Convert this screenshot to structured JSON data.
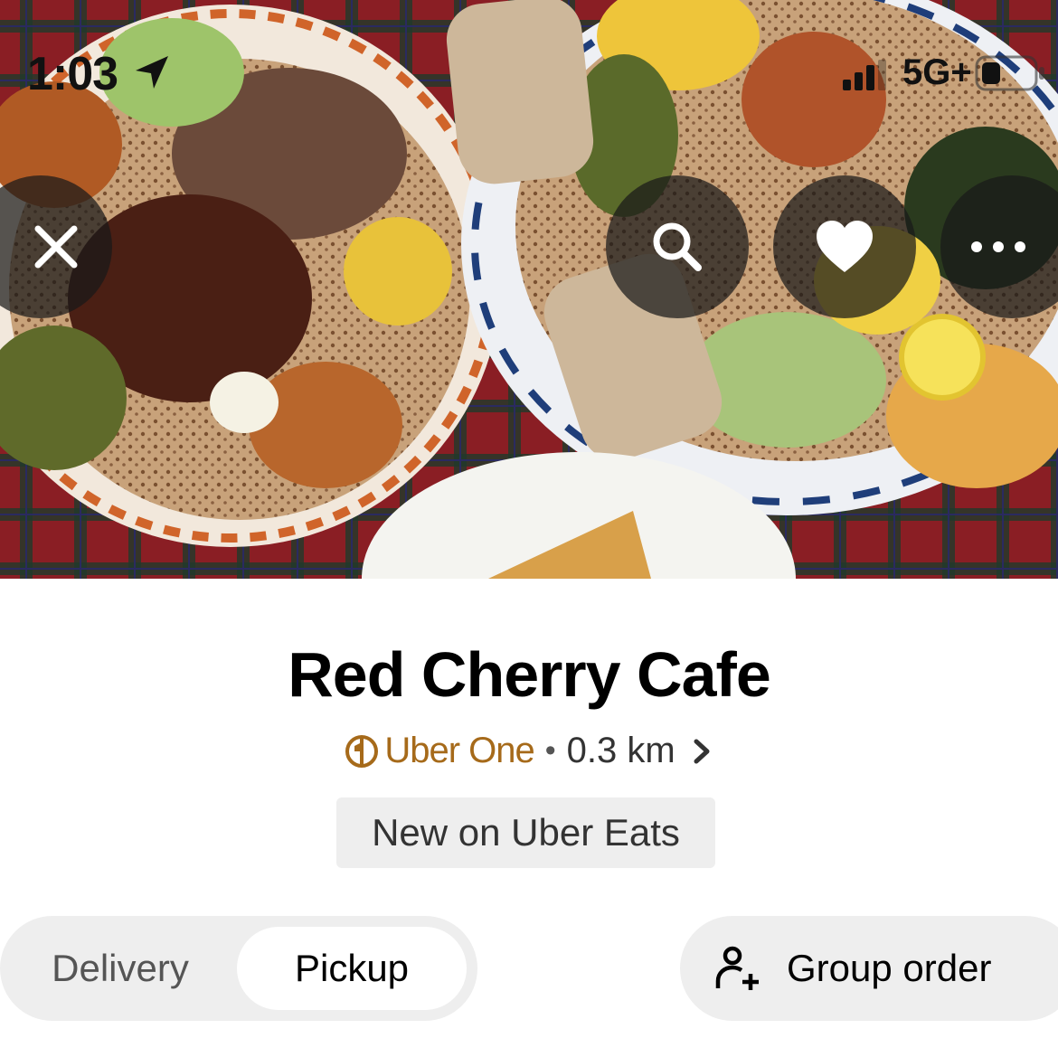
{
  "status_bar": {
    "time": "1:03",
    "network": "5G+"
  },
  "hero": {
    "close_icon": "close-icon",
    "search_icon": "search-icon",
    "favorite_icon": "heart-icon",
    "more_icon": "more-horizontal-icon"
  },
  "store": {
    "name": "Red Cherry Cafe",
    "membership": "Uber One",
    "separator": "•",
    "distance": "0.3 km",
    "badge": "New on Uber Eats"
  },
  "mode_toggle": {
    "options": [
      "Delivery",
      "Pickup"
    ],
    "selected": "Pickup"
  },
  "group_order": {
    "label": "Group order"
  },
  "colors": {
    "uber_one": "#a66a1a",
    "chip_bg": "#eeeeee",
    "overlay_btn": "#191919"
  }
}
